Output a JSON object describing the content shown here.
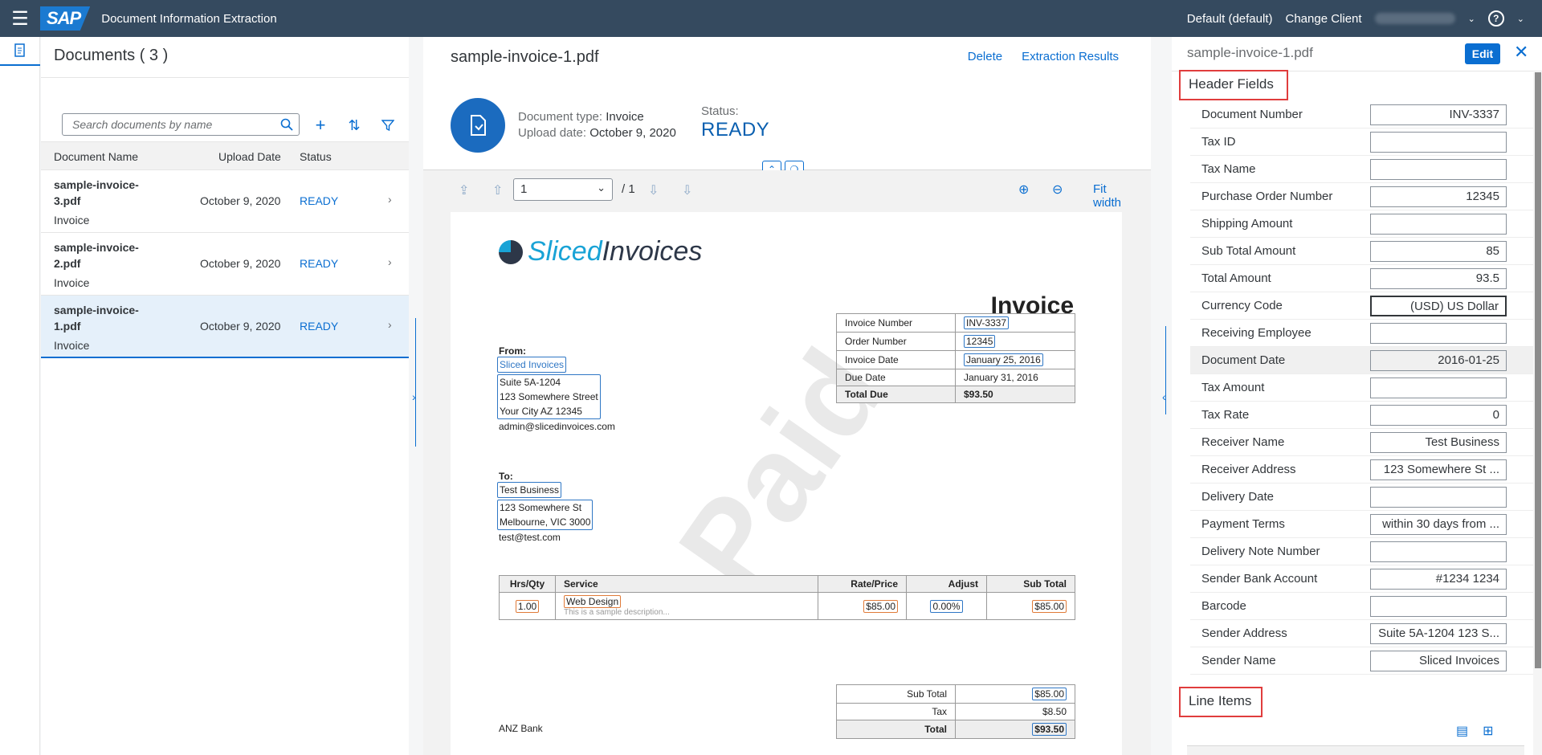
{
  "shell": {
    "logo": "SAP",
    "app_title": "Document Information Extraction",
    "tenant": "Default (default)",
    "change_client": "Change Client"
  },
  "docs": {
    "title": "Documents ( 3 )",
    "search_placeholder": "Search documents by name",
    "columns": [
      "Document Name",
      "Upload Date",
      "Status"
    ],
    "rows": [
      {
        "name": "sample-invoice-3.pdf",
        "type": "Invoice",
        "date": "October 9, 2020",
        "status": "READY"
      },
      {
        "name": "sample-invoice-2.pdf",
        "type": "Invoice",
        "date": "October 9, 2020",
        "status": "READY"
      },
      {
        "name": "sample-invoice-1.pdf",
        "type": "Invoice",
        "date": "October 9, 2020",
        "status": "READY"
      }
    ]
  },
  "center": {
    "title": "sample-invoice-1.pdf",
    "delete": "Delete",
    "extraction_results": "Extraction Results",
    "doc_type_label": "Document type:",
    "doc_type": "Invoice",
    "upload_label": "Upload date:",
    "upload_date": "October 9, 2020",
    "status_label": "Status:",
    "status": "READY",
    "page_current": "1",
    "page_total": "/ 1",
    "fit_width": "Fit width"
  },
  "invoice": {
    "brand_1": "Sliced",
    "brand_2": "Invoices",
    "heading": "Invoice",
    "from_label": "From:",
    "from_name": "Sliced Invoices",
    "from_addr": [
      "Suite 5A-1204",
      "123 Somewhere Street",
      "Your City AZ 12345"
    ],
    "from_email": "admin@slicedinvoices.com",
    "to_label": "To:",
    "to_name": "Test Business",
    "to_addr": [
      "123 Somewhere St",
      "Melbourne, VIC 3000"
    ],
    "to_email": "test@test.com",
    "summary": [
      {
        "k": "Invoice Number",
        "v": "INV-3337"
      },
      {
        "k": "Order Number",
        "v": "12345"
      },
      {
        "k": "Invoice Date",
        "v": "January 25, 2016"
      },
      {
        "k": "Due Date",
        "v": "January 31, 2016"
      },
      {
        "k": "Total Due",
        "v": "$93.50"
      }
    ],
    "items_head": [
      "Hrs/Qty",
      "Service",
      "Rate/Price",
      "Adjust",
      "Sub Total"
    ],
    "item": {
      "qty": "1.00",
      "service": "Web Design",
      "desc": "This is a sample description...",
      "rate": "$85.00",
      "adjust": "0.00%",
      "sub": "$85.00"
    },
    "totals": [
      {
        "k": "Sub Total",
        "v": "$85.00"
      },
      {
        "k": "Tax",
        "v": "$8.50"
      },
      {
        "k": "Total",
        "v": "$93.50"
      }
    ],
    "bank": "ANZ Bank",
    "watermark": "Paid"
  },
  "right": {
    "title": "sample-invoice-1.pdf",
    "edit": "Edit",
    "header_fields_title": "Header Fields",
    "line_items_title": "Line Items",
    "fields": [
      {
        "label": "Document Number",
        "value": "INV-3337"
      },
      {
        "label": "Tax ID",
        "value": ""
      },
      {
        "label": "Tax Name",
        "value": ""
      },
      {
        "label": "Purchase Order Number",
        "value": "12345"
      },
      {
        "label": "Shipping Amount",
        "value": ""
      },
      {
        "label": "Sub Total Amount",
        "value": "85"
      },
      {
        "label": "Total Amount",
        "value": "93.5"
      },
      {
        "label": "Currency Code",
        "value": "(USD) US Dollar"
      },
      {
        "label": "Receiving Employee",
        "value": ""
      },
      {
        "label": "Document Date",
        "value": "2016-01-25"
      },
      {
        "label": "Tax Amount",
        "value": ""
      },
      {
        "label": "Tax Rate",
        "value": "0"
      },
      {
        "label": "Receiver Name",
        "value": "Test Business"
      },
      {
        "label": "Receiver Address",
        "value": "123 Somewhere St ..."
      },
      {
        "label": "Delivery Date",
        "value": ""
      },
      {
        "label": "Payment Terms",
        "value": "within 30 days from ..."
      },
      {
        "label": "Delivery Note Number",
        "value": ""
      },
      {
        "label": "Sender Bank Account",
        "value": "#1234 1234"
      },
      {
        "label": "Barcode",
        "value": ""
      },
      {
        "label": "Sender Address",
        "value": "Suite 5A-1204 123 S..."
      },
      {
        "label": "Sender Name",
        "value": "Sliced Invoices"
      }
    ]
  }
}
